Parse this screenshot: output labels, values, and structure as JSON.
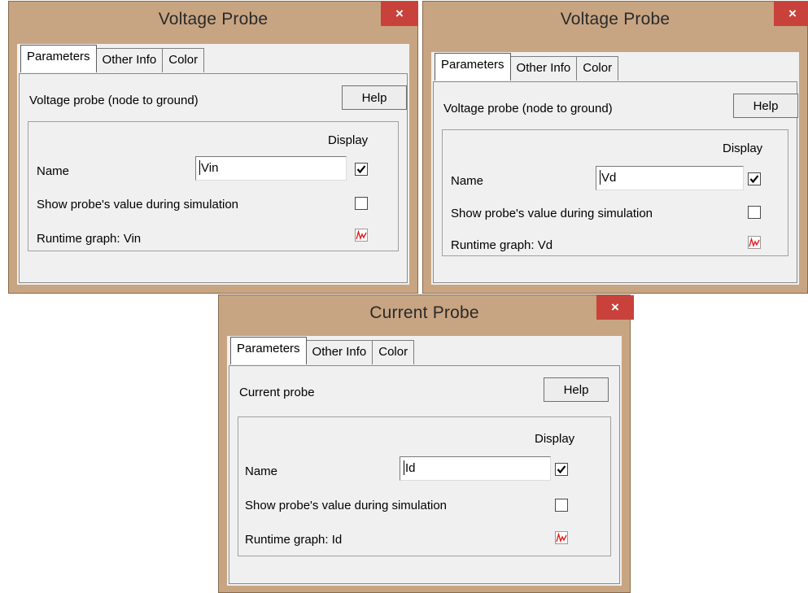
{
  "dialogs": [
    {
      "title": "Voltage Probe",
      "close_label": "×",
      "tabs": [
        "Parameters",
        "Other Info",
        "Color"
      ],
      "active_tab": "Parameters",
      "description": "Voltage probe (node to ground)",
      "help_label": "Help",
      "display_label": "Display",
      "name_label": "Name",
      "name_value": "Vin",
      "show_value_label": "Show probe's value during simulation",
      "runtime_graph_label": "Runtime graph: Vin",
      "display_name_checked": true,
      "show_value_checked": false,
      "runtime_graph_icon": "red-waveform-graph-icon"
    },
    {
      "title": "Voltage Probe",
      "close_label": "×",
      "tabs": [
        "Parameters",
        "Other Info",
        "Color"
      ],
      "active_tab": "Parameters",
      "description": "Voltage probe (node to ground)",
      "help_label": "Help",
      "display_label": "Display",
      "name_label": "Name",
      "name_value": "Vd",
      "show_value_label": "Show probe's value during simulation",
      "runtime_graph_label": "Runtime graph: Vd",
      "display_name_checked": true,
      "show_value_checked": false,
      "runtime_graph_icon": "red-waveform-graph-icon"
    },
    {
      "title": "Current Probe",
      "close_label": "×",
      "tabs": [
        "Parameters",
        "Other Info",
        "Color"
      ],
      "active_tab": "Parameters",
      "description": "Current probe",
      "help_label": "Help",
      "display_label": "Display",
      "name_label": "Name",
      "name_value": "Id",
      "show_value_label": "Show probe's value during simulation",
      "runtime_graph_label": "Runtime graph: Id",
      "display_name_checked": true,
      "show_value_checked": false,
      "runtime_graph_icon": "red-waveform-graph-icon"
    }
  ],
  "colors": {
    "window_frame": "#c8a582",
    "close_button": "#c9413b",
    "dialog_face": "#f0f0f0",
    "graph_icon_red": "#e02020"
  }
}
